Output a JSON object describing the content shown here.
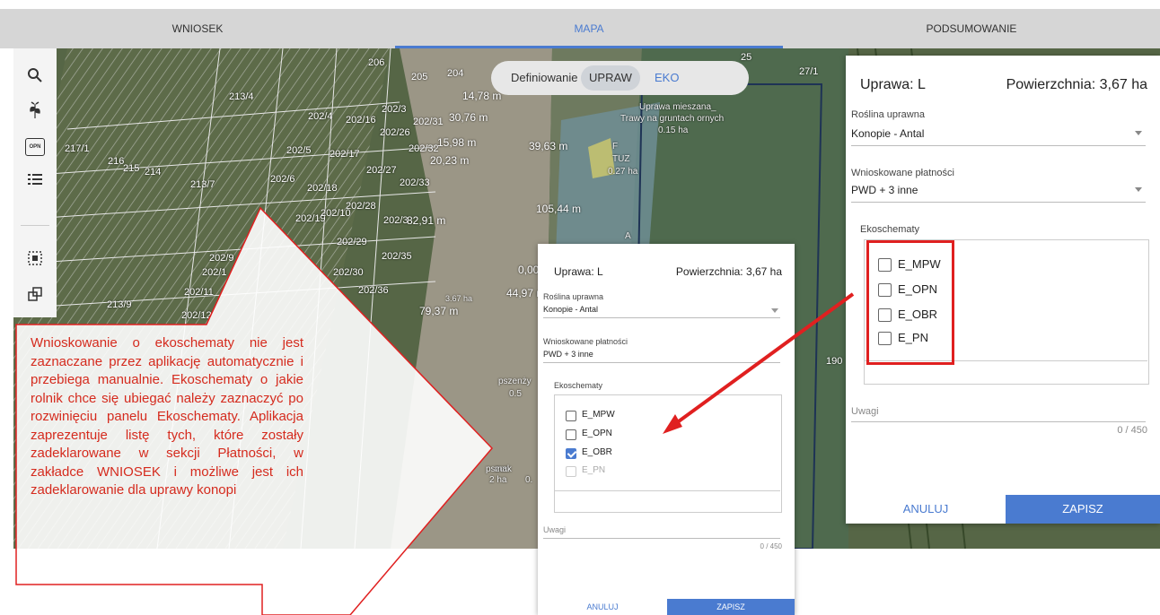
{
  "tabs": [
    "WNIOSEK",
    "MAPA",
    "PODSUMOWANIE"
  ],
  "toolbar": {
    "icons": [
      "search-icon",
      "plant-icon",
      "opn-icon",
      "list-icon",
      "select-area-icon",
      "copy-icon"
    ],
    "opn_text": "OPN"
  },
  "mode_switch": {
    "label": "Definiowanie",
    "selected": "UPRAW",
    "other": "EKO"
  },
  "map_labels": {
    "parcels": [
      "206",
      "205",
      "204",
      "213/4",
      "202/4",
      "202/16",
      "202/3",
      "202/31",
      "202/26",
      "217/1",
      "216",
      "215",
      "214",
      "202/5",
      "202/17",
      "202/32",
      "202/27",
      "202/33",
      "213/7",
      "202/6",
      "202/18",
      "202/28",
      "202/19",
      "202/10",
      "202/3",
      "202/29",
      "202/9",
      "202/35",
      "202/1",
      "202/30",
      "202/11",
      "202/36",
      "213/9",
      "202/12",
      "25",
      "27/1",
      "190"
    ],
    "distances": [
      "14,78 m",
      "30,76 m",
      "15,98 m",
      "39,63 m",
      "20,23 m",
      "105,44 m",
      "82,91 m",
      "44,97 m",
      "79,37 m",
      "0,00"
    ],
    "crops": [
      "Uprawa mieszana_",
      "Trawy na gruntach ornych",
      "0.15 ha",
      "F",
      "TUZ",
      "0.27 ha",
      "A",
      "3.67 ha",
      "pszenży",
      "0.5",
      "pszen",
      "0.",
      "mak",
      "2 ha"
    ]
  },
  "panel_big": {
    "title": "Uprawa: L",
    "area_label": "Powierzchnia: 3,67 ha",
    "crop_label": "Roślina uprawna",
    "crop_value": "Konopie - Antal",
    "payments_label": "Wnioskowane płatności",
    "payments_value": "PWD + 3 inne",
    "eco_label": "Ekoschematy",
    "eco_items": [
      {
        "label": "E_MPW",
        "checked": false,
        "disabled": false
      },
      {
        "label": "E_OPN",
        "checked": false,
        "disabled": false
      },
      {
        "label": "E_OBR",
        "checked": false,
        "disabled": false
      },
      {
        "label": "E_PN",
        "checked": false,
        "disabled": false
      }
    ],
    "notes_label": "Uwagi",
    "counter": "0 / 450",
    "cancel": "ANULUJ",
    "save": "ZAPISZ"
  },
  "panel_small": {
    "title": "Uprawa: L",
    "area_label": "Powierzchnia: 3,67 ha",
    "crop_label": "Roślina uprawna",
    "crop_value": "Konopie - Antal",
    "payments_label": "Wnioskowane płatności",
    "payments_value": "PWD + 3 inne",
    "eco_label": "Ekoschematy",
    "eco_items": [
      {
        "label": "E_MPW",
        "checked": false,
        "disabled": false
      },
      {
        "label": "E_OPN",
        "checked": false,
        "disabled": false
      },
      {
        "label": "E_OBR",
        "checked": true,
        "disabled": false
      },
      {
        "label": "E_PN",
        "checked": false,
        "disabled": true
      }
    ],
    "notes_label": "Uwagi",
    "counter": "0 / 450",
    "cancel": "ANULUJ",
    "save": "ZAPISZ"
  },
  "callout": "Wnioskowanie o ekoschematy nie jest zaznaczane przez aplikację automatycznie i przebiega manualnie. Ekoschematy o jakie rolnik chce się ubiegać należy zaznaczyć po rozwinięciu panelu Ekoschematy. Aplikacja zaprezentuje listę tych, które zostały zadeklarowane w sekcji Płatności, w zakładce WNIOSEK i możliwe jest ich zadeklarowanie dla uprawy konopi",
  "colors": {
    "accent": "#4a7bd0",
    "annotation": "#e02020",
    "map": "#4d5a3d"
  }
}
